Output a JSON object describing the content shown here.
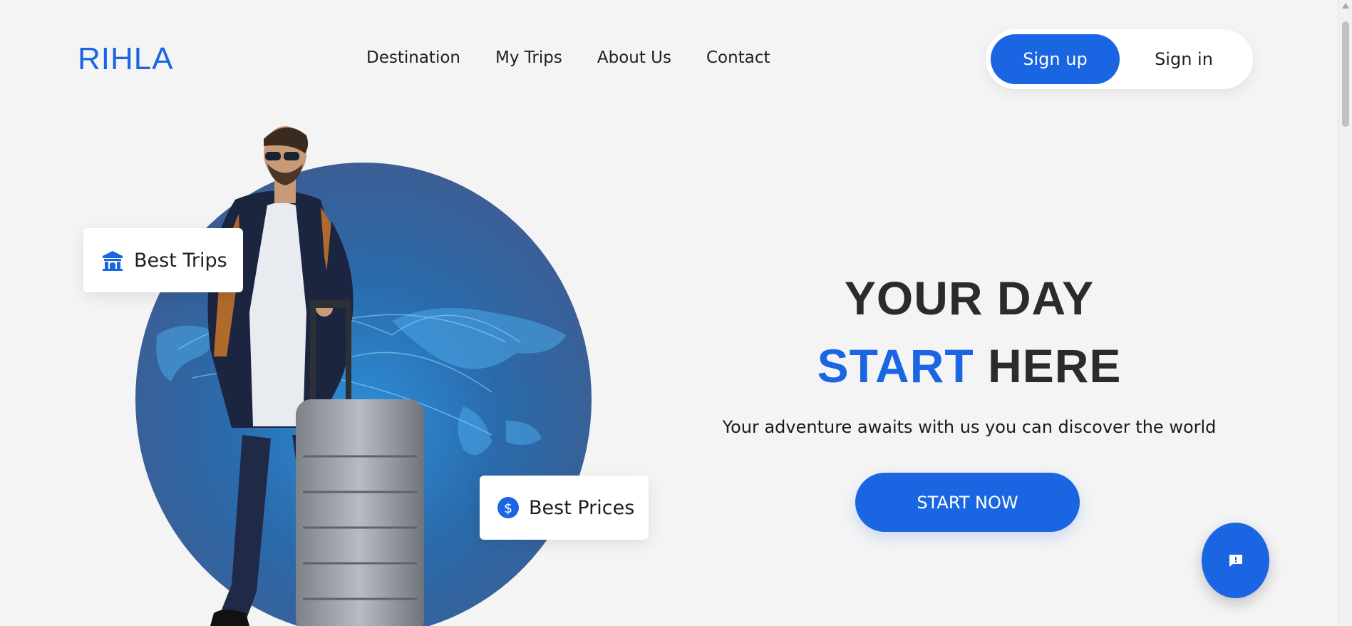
{
  "header": {
    "logo": "RIHLA",
    "nav": [
      "Destination",
      "My Trips",
      "About Us",
      "Contact"
    ],
    "signup_label": "Sign up",
    "signin_label": "Sign in"
  },
  "hero": {
    "badge_trips": "Best Trips",
    "badge_prices": "Best Prices",
    "headline_line1": "YOUR DAY",
    "headline_line2_accent": "START",
    "headline_line2_rest": " HERE",
    "subtitle": "Your adventure awaits with us you can discover the world",
    "cta_label": "START NOW"
  },
  "icons": {
    "trips": "building-icon",
    "prices": "dollar-circle-icon",
    "chat": "chat-alert-icon"
  },
  "colors": {
    "accent": "#1a66e2",
    "background": "#f4f4f4",
    "text": "#2b2b2b"
  }
}
